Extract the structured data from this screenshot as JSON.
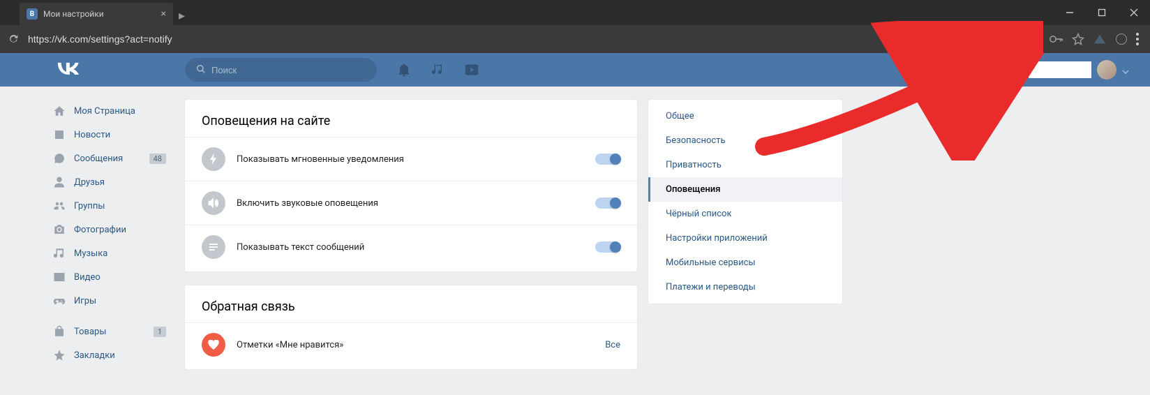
{
  "browser": {
    "tab_title": "Мои настройки",
    "url": "https://vk.com/settings?act=notify"
  },
  "header": {
    "search_placeholder": "Поиск"
  },
  "left_nav": {
    "items": [
      {
        "key": "my-page",
        "label": "Моя Страница"
      },
      {
        "key": "news",
        "label": "Новости"
      },
      {
        "key": "messages",
        "label": "Сообщения",
        "badge": "48"
      },
      {
        "key": "friends",
        "label": "Друзья"
      },
      {
        "key": "groups",
        "label": "Группы"
      },
      {
        "key": "photos",
        "label": "Фотографии"
      },
      {
        "key": "music",
        "label": "Музыка"
      },
      {
        "key": "video",
        "label": "Видео"
      },
      {
        "key": "games",
        "label": "Игры"
      },
      {
        "key": "shop",
        "label": "Товары",
        "badge": "1"
      },
      {
        "key": "bookmarks",
        "label": "Закладки"
      }
    ]
  },
  "settings": {
    "site_notifications_title": "Оповещения на сайте",
    "rows": [
      {
        "label": "Показывать мгновенные уведомления"
      },
      {
        "label": "Включить звуковые оповещения"
      },
      {
        "label": "Показывать текст сообщений"
      }
    ],
    "feedback_title": "Обратная связь",
    "likes_label": "Отметки «Мне нравится»",
    "likes_link": "Все"
  },
  "tabs": {
    "items": [
      {
        "key": "general",
        "label": "Общее"
      },
      {
        "key": "security",
        "label": "Безопасность"
      },
      {
        "key": "privacy",
        "label": "Приватность"
      },
      {
        "key": "notifications",
        "label": "Оповещения",
        "active": true
      },
      {
        "key": "blacklist",
        "label": "Чёрный список"
      },
      {
        "key": "apps",
        "label": "Настройки приложений"
      },
      {
        "key": "mobile",
        "label": "Мобильные сервисы"
      },
      {
        "key": "payments",
        "label": "Платежи и переводы"
      }
    ]
  }
}
